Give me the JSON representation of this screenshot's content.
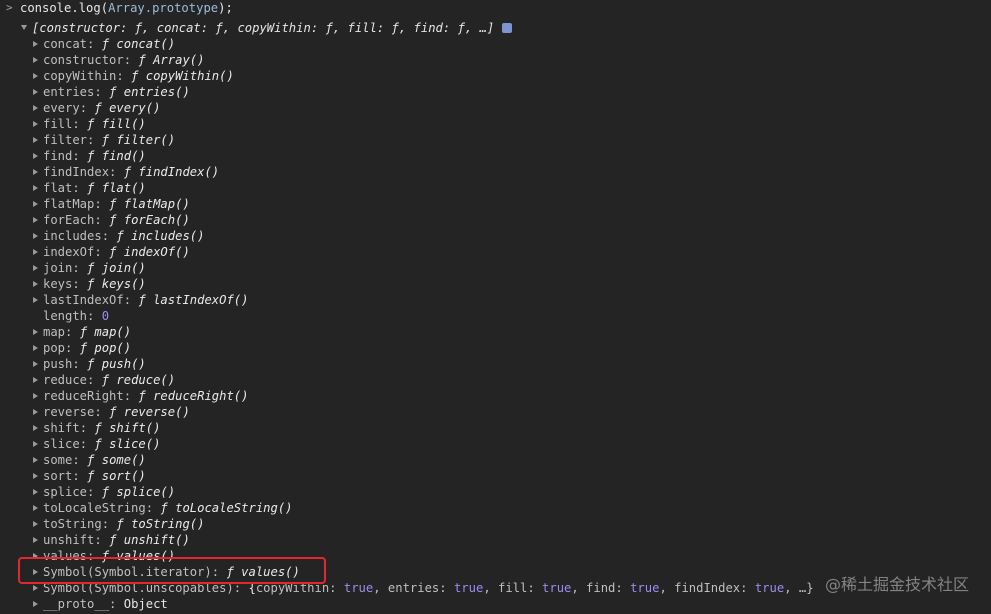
{
  "console": {
    "prompt_symbol": ">",
    "command": {
      "prefix": "console.log(",
      "arg": "Array.prototype",
      "suffix": ");"
    },
    "root_summary": "[constructor: ƒ, concat: ƒ, copyWithin: ƒ, fill: ƒ, find: ƒ, …]",
    "entries": [
      {
        "key": "concat",
        "type": "fn",
        "value": "concat()"
      },
      {
        "key": "constructor",
        "type": "fn",
        "value": "Array()"
      },
      {
        "key": "copyWithin",
        "type": "fn",
        "value": "copyWithin()"
      },
      {
        "key": "entries",
        "type": "fn",
        "value": "entries()"
      },
      {
        "key": "every",
        "type": "fn",
        "value": "every()"
      },
      {
        "key": "fill",
        "type": "fn",
        "value": "fill()"
      },
      {
        "key": "filter",
        "type": "fn",
        "value": "filter()"
      },
      {
        "key": "find",
        "type": "fn",
        "value": "find()"
      },
      {
        "key": "findIndex",
        "type": "fn",
        "value": "findIndex()"
      },
      {
        "key": "flat",
        "type": "fn",
        "value": "flat()"
      },
      {
        "key": "flatMap",
        "type": "fn",
        "value": "flatMap()"
      },
      {
        "key": "forEach",
        "type": "fn",
        "value": "forEach()"
      },
      {
        "key": "includes",
        "type": "fn",
        "value": "includes()"
      },
      {
        "key": "indexOf",
        "type": "fn",
        "value": "indexOf()"
      },
      {
        "key": "join",
        "type": "fn",
        "value": "join()"
      },
      {
        "key": "keys",
        "type": "fn",
        "value": "keys()"
      },
      {
        "key": "lastIndexOf",
        "type": "fn",
        "value": "lastIndexOf()"
      },
      {
        "key": "length",
        "type": "num",
        "value": "0"
      },
      {
        "key": "map",
        "type": "fn",
        "value": "map()"
      },
      {
        "key": "pop",
        "type": "fn",
        "value": "pop()"
      },
      {
        "key": "push",
        "type": "fn",
        "value": "push()"
      },
      {
        "key": "reduce",
        "type": "fn",
        "value": "reduce()"
      },
      {
        "key": "reduceRight",
        "type": "fn",
        "value": "reduceRight()"
      },
      {
        "key": "reverse",
        "type": "fn",
        "value": "reverse()"
      },
      {
        "key": "shift",
        "type": "fn",
        "value": "shift()"
      },
      {
        "key": "slice",
        "type": "fn",
        "value": "slice()"
      },
      {
        "key": "some",
        "type": "fn",
        "value": "some()"
      },
      {
        "key": "sort",
        "type": "fn",
        "value": "sort()"
      },
      {
        "key": "splice",
        "type": "fn",
        "value": "splice()"
      },
      {
        "key": "toLocaleString",
        "type": "fn",
        "value": "toLocaleString()"
      },
      {
        "key": "toString",
        "type": "fn",
        "value": "toString()"
      },
      {
        "key": "unshift",
        "type": "fn",
        "value": "unshift()"
      },
      {
        "key": "values",
        "type": "fn",
        "value": "values()"
      },
      {
        "key": "Symbol(Symbol.iterator)",
        "type": "fn",
        "value": "values()"
      },
      {
        "key": "Symbol(Symbol.unscopables)",
        "type": "obj",
        "value": ""
      },
      {
        "key": "__proto__",
        "type": "plain",
        "value": "Object"
      }
    ],
    "function_symbol": "ƒ",
    "unscopables_summary": {
      "open": "{",
      "items": [
        {
          "k": "copyWithin",
          "v": "true"
        },
        {
          "k": "entries",
          "v": "true"
        },
        {
          "k": "fill",
          "v": "true"
        },
        {
          "k": "find",
          "v": "true"
        },
        {
          "k": "findIndex",
          "v": "true"
        }
      ],
      "tail": ", …}"
    }
  },
  "watermark": "@稀土掘金技术社区",
  "highlight_color": "#e0282e"
}
